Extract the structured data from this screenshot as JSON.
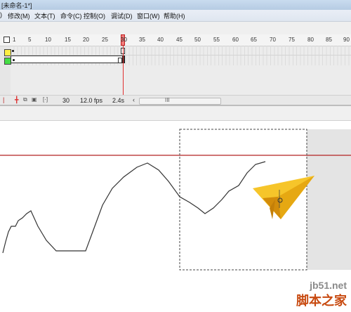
{
  "window": {
    "title": "[未命名-1*]"
  },
  "menu": {
    "items": [
      "修改(M)",
      "文本(T)",
      "命令(C)",
      "控制(O)",
      "调试(D)",
      "窗口(W)",
      "帮助(H)"
    ]
  },
  "timeline": {
    "ruler_labels": [
      "1",
      "5",
      "10",
      "15",
      "20",
      "25",
      "30",
      "35",
      "40",
      "45",
      "50",
      "55",
      "60",
      "65",
      "70",
      "75",
      "80",
      "85",
      "90"
    ],
    "current_frame": "30",
    "frame_rate": "12.0 fps",
    "elapsed_time": "2.4s",
    "scroll_grip": "III",
    "layer_colors": [
      "#ffee44",
      "#44dd44"
    ]
  },
  "watermark": {
    "url": "jb51.net",
    "name": "脚本之家"
  }
}
